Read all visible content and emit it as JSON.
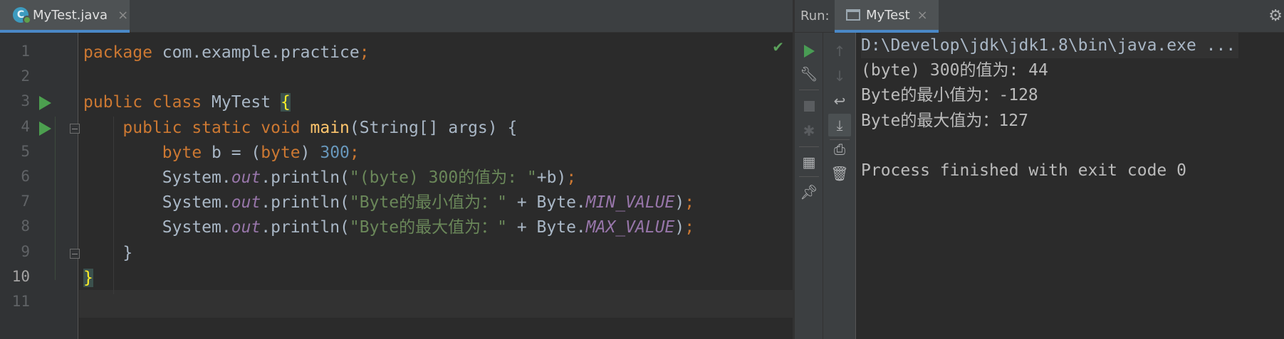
{
  "editor": {
    "tab": {
      "label": "MyTest.java",
      "close": "×"
    },
    "status_check": "✔",
    "lines": [
      {
        "num": "1",
        "tokens": [
          {
            "t": "package ",
            "c": "kw"
          },
          {
            "t": "com.example.practice",
            "c": ""
          },
          {
            "t": ";",
            "c": "kw"
          }
        ]
      },
      {
        "num": "2",
        "tokens": []
      },
      {
        "num": "3",
        "run": true,
        "tokens": [
          {
            "t": "public ",
            "c": "kw"
          },
          {
            "t": "class ",
            "c": "kw"
          },
          {
            "t": "MyTest ",
            "c": ""
          },
          {
            "t": "{",
            "c": "brace-hl"
          }
        ]
      },
      {
        "num": "4",
        "run": true,
        "fold": true,
        "tokens": [
          {
            "t": "    public ",
            "c": "kw"
          },
          {
            "t": "static ",
            "c": "kw"
          },
          {
            "t": "void ",
            "c": "kw"
          },
          {
            "t": "main",
            "c": "fn"
          },
          {
            "t": "(String[] args) {",
            "c": ""
          }
        ]
      },
      {
        "num": "5",
        "tokens": [
          {
            "t": "        byte ",
            "c": "kw"
          },
          {
            "t": "b = (",
            "c": ""
          },
          {
            "t": "byte",
            "c": "kw"
          },
          {
            "t": ") ",
            "c": ""
          },
          {
            "t": "300",
            "c": "num"
          },
          {
            "t": ";",
            "c": "kw"
          }
        ]
      },
      {
        "num": "6",
        "tokens": [
          {
            "t": "        System.",
            "c": ""
          },
          {
            "t": "out",
            "c": "fld"
          },
          {
            "t": ".println(",
            "c": ""
          },
          {
            "t": "\"(byte) 300的值为: \"",
            "c": "str"
          },
          {
            "t": "+b)",
            "c": ""
          },
          {
            "t": ";",
            "c": "kw"
          }
        ]
      },
      {
        "num": "7",
        "tokens": [
          {
            "t": "        System.",
            "c": ""
          },
          {
            "t": "out",
            "c": "fld"
          },
          {
            "t": ".println(",
            "c": ""
          },
          {
            "t": "\"Byte的最小值为：\"",
            "c": "str"
          },
          {
            "t": " + Byte.",
            "c": ""
          },
          {
            "t": "MIN_VALUE",
            "c": "fld"
          },
          {
            "t": ")",
            "c": ""
          },
          {
            "t": ";",
            "c": "kw"
          }
        ]
      },
      {
        "num": "8",
        "tokens": [
          {
            "t": "        System.",
            "c": ""
          },
          {
            "t": "out",
            "c": "fld"
          },
          {
            "t": ".println(",
            "c": ""
          },
          {
            "t": "\"Byte的最大值为：\"",
            "c": "str"
          },
          {
            "t": " + Byte.",
            "c": ""
          },
          {
            "t": "MAX_VALUE",
            "c": "fld"
          },
          {
            "t": ")",
            "c": ""
          },
          {
            "t": ";",
            "c": "kw"
          }
        ]
      },
      {
        "num": "9",
        "fold": true,
        "tokens": [
          {
            "t": "    }",
            "c": ""
          }
        ]
      },
      {
        "num": "10",
        "current": true,
        "tokens": [
          {
            "t": "}",
            "c": "brace-hl"
          }
        ]
      },
      {
        "num": "11",
        "tokens": []
      }
    ]
  },
  "run_window": {
    "title": "Run:",
    "tab": {
      "label": "MyTest",
      "close": "×"
    },
    "settings_icon": "gear-icon",
    "toolbar_left": [
      "rerun-icon",
      "wrench-icon",
      "stop-icon",
      "debug-icon",
      "layout-icon",
      "pin-icon"
    ],
    "toolbar_right": [
      "up-arrow-icon",
      "down-arrow-icon",
      "soft-wrap-icon",
      "scroll-to-end-icon",
      "print-icon",
      "trash-icon"
    ],
    "console_lines": [
      "D:\\Develop\\jdk\\jdk1.8\\bin\\java.exe ...",
      "(byte) 300的值为: 44",
      "Byte的最小值为：-128",
      "Byte的最大值为：127",
      "",
      "Process finished with exit code 0"
    ]
  },
  "colors": {
    "keyword": "#cc7832",
    "string": "#6a8759",
    "number": "#6897bb",
    "field": "#9876aa",
    "method": "#ffc66d",
    "run": "#499c54",
    "accent": "#4a88c7"
  }
}
